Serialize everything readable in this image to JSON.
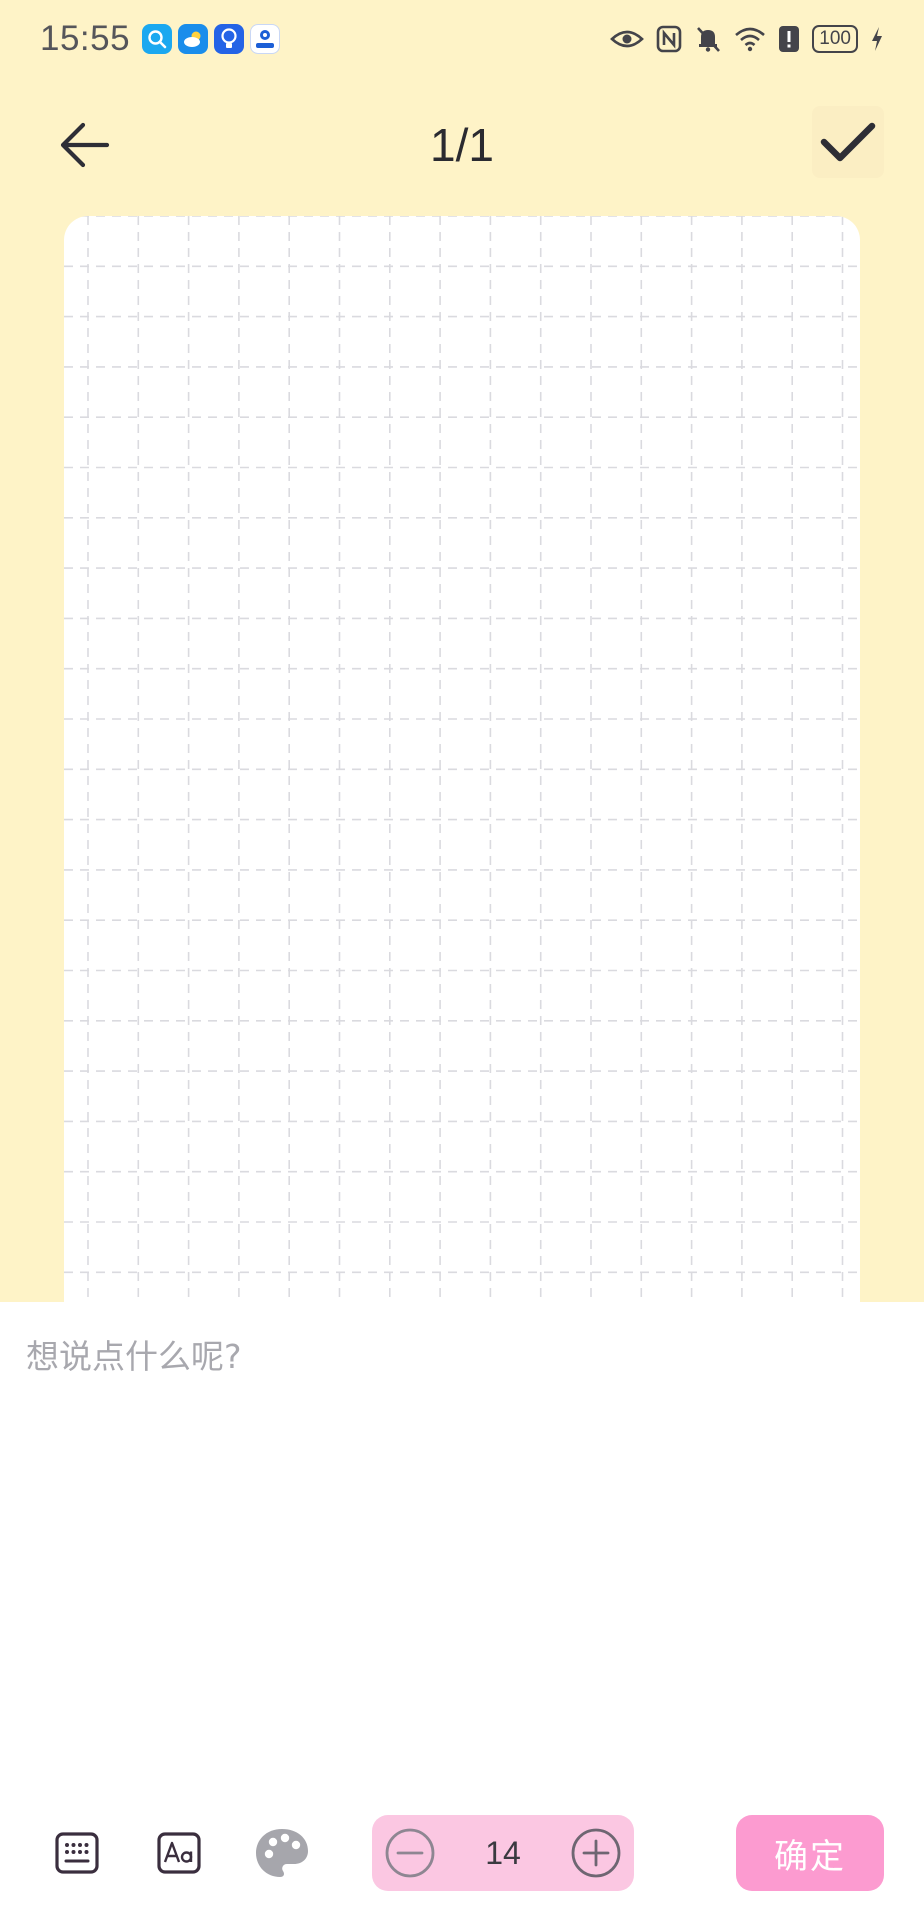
{
  "status_bar": {
    "time": "15:55",
    "battery": "100",
    "app_icons": [
      "search-app-icon",
      "weather-app-icon",
      "bulb-app-icon",
      "profile-app-icon"
    ],
    "indicators": [
      "eye-icon",
      "nfc-icon",
      "bell-off-icon",
      "wifi-icon",
      "alert-icon",
      "battery-icon",
      "charging-icon"
    ]
  },
  "header": {
    "page_indicator": "1/1"
  },
  "editor": {
    "placeholder": "想说点什么呢?"
  },
  "toolbar": {
    "font_size": "14",
    "confirm_label": "确定"
  },
  "colors": {
    "background": "#FEF3C7",
    "stepper_bg": "#FBC7E2",
    "confirm_bg": "#FC9BD0",
    "grid_line": "#DADADF"
  }
}
